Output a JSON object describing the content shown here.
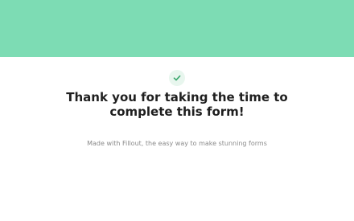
{
  "header": {
    "banner_color": "#7ddcb4"
  },
  "confirmation": {
    "icon": "check-icon",
    "icon_color": "#3aa76d",
    "title_line_1": "Thank you for taking the time to",
    "title_line_2": "complete this form!"
  },
  "footer": {
    "text": "Made with Fillout, the easy way to make stunning forms"
  }
}
